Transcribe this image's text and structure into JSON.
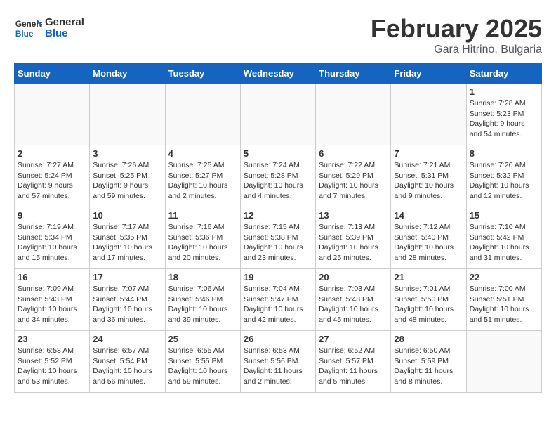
{
  "header": {
    "logo_general": "General",
    "logo_blue": "Blue",
    "month_title": "February 2025",
    "location": "Gara Hitrino, Bulgaria"
  },
  "days_of_week": [
    "Sunday",
    "Monday",
    "Tuesday",
    "Wednesday",
    "Thursday",
    "Friday",
    "Saturday"
  ],
  "weeks": [
    [
      {
        "day": "",
        "info": ""
      },
      {
        "day": "",
        "info": ""
      },
      {
        "day": "",
        "info": ""
      },
      {
        "day": "",
        "info": ""
      },
      {
        "day": "",
        "info": ""
      },
      {
        "day": "",
        "info": ""
      },
      {
        "day": "1",
        "info": "Sunrise: 7:28 AM\nSunset: 5:23 PM\nDaylight: 9 hours and 54 minutes."
      }
    ],
    [
      {
        "day": "2",
        "info": "Sunrise: 7:27 AM\nSunset: 5:24 PM\nDaylight: 9 hours and 57 minutes."
      },
      {
        "day": "3",
        "info": "Sunrise: 7:26 AM\nSunset: 5:25 PM\nDaylight: 9 hours and 59 minutes."
      },
      {
        "day": "4",
        "info": "Sunrise: 7:25 AM\nSunset: 5:27 PM\nDaylight: 10 hours and 2 minutes."
      },
      {
        "day": "5",
        "info": "Sunrise: 7:24 AM\nSunset: 5:28 PM\nDaylight: 10 hours and 4 minutes."
      },
      {
        "day": "6",
        "info": "Sunrise: 7:22 AM\nSunset: 5:29 PM\nDaylight: 10 hours and 7 minutes."
      },
      {
        "day": "7",
        "info": "Sunrise: 7:21 AM\nSunset: 5:31 PM\nDaylight: 10 hours and 9 minutes."
      },
      {
        "day": "8",
        "info": "Sunrise: 7:20 AM\nSunset: 5:32 PM\nDaylight: 10 hours and 12 minutes."
      }
    ],
    [
      {
        "day": "9",
        "info": "Sunrise: 7:19 AM\nSunset: 5:34 PM\nDaylight: 10 hours and 15 minutes."
      },
      {
        "day": "10",
        "info": "Sunrise: 7:17 AM\nSunset: 5:35 PM\nDaylight: 10 hours and 17 minutes."
      },
      {
        "day": "11",
        "info": "Sunrise: 7:16 AM\nSunset: 5:36 PM\nDaylight: 10 hours and 20 minutes."
      },
      {
        "day": "12",
        "info": "Sunrise: 7:15 AM\nSunset: 5:38 PM\nDaylight: 10 hours and 23 minutes."
      },
      {
        "day": "13",
        "info": "Sunrise: 7:13 AM\nSunset: 5:39 PM\nDaylight: 10 hours and 25 minutes."
      },
      {
        "day": "14",
        "info": "Sunrise: 7:12 AM\nSunset: 5:40 PM\nDaylight: 10 hours and 28 minutes."
      },
      {
        "day": "15",
        "info": "Sunrise: 7:10 AM\nSunset: 5:42 PM\nDaylight: 10 hours and 31 minutes."
      }
    ],
    [
      {
        "day": "16",
        "info": "Sunrise: 7:09 AM\nSunset: 5:43 PM\nDaylight: 10 hours and 34 minutes."
      },
      {
        "day": "17",
        "info": "Sunrise: 7:07 AM\nSunset: 5:44 PM\nDaylight: 10 hours and 36 minutes."
      },
      {
        "day": "18",
        "info": "Sunrise: 7:06 AM\nSunset: 5:46 PM\nDaylight: 10 hours and 39 minutes."
      },
      {
        "day": "19",
        "info": "Sunrise: 7:04 AM\nSunset: 5:47 PM\nDaylight: 10 hours and 42 minutes."
      },
      {
        "day": "20",
        "info": "Sunrise: 7:03 AM\nSunset: 5:48 PM\nDaylight: 10 hours and 45 minutes."
      },
      {
        "day": "21",
        "info": "Sunrise: 7:01 AM\nSunset: 5:50 PM\nDaylight: 10 hours and 48 minutes."
      },
      {
        "day": "22",
        "info": "Sunrise: 7:00 AM\nSunset: 5:51 PM\nDaylight: 10 hours and 51 minutes."
      }
    ],
    [
      {
        "day": "23",
        "info": "Sunrise: 6:58 AM\nSunset: 5:52 PM\nDaylight: 10 hours and 53 minutes."
      },
      {
        "day": "24",
        "info": "Sunrise: 6:57 AM\nSunset: 5:54 PM\nDaylight: 10 hours and 56 minutes."
      },
      {
        "day": "25",
        "info": "Sunrise: 6:55 AM\nSunset: 5:55 PM\nDaylight: 10 hours and 59 minutes."
      },
      {
        "day": "26",
        "info": "Sunrise: 6:53 AM\nSunset: 5:56 PM\nDaylight: 11 hours and 2 minutes."
      },
      {
        "day": "27",
        "info": "Sunrise: 6:52 AM\nSunset: 5:57 PM\nDaylight: 11 hours and 5 minutes."
      },
      {
        "day": "28",
        "info": "Sunrise: 6:50 AM\nSunset: 5:59 PM\nDaylight: 11 hours and 8 minutes."
      },
      {
        "day": "",
        "info": ""
      }
    ]
  ]
}
